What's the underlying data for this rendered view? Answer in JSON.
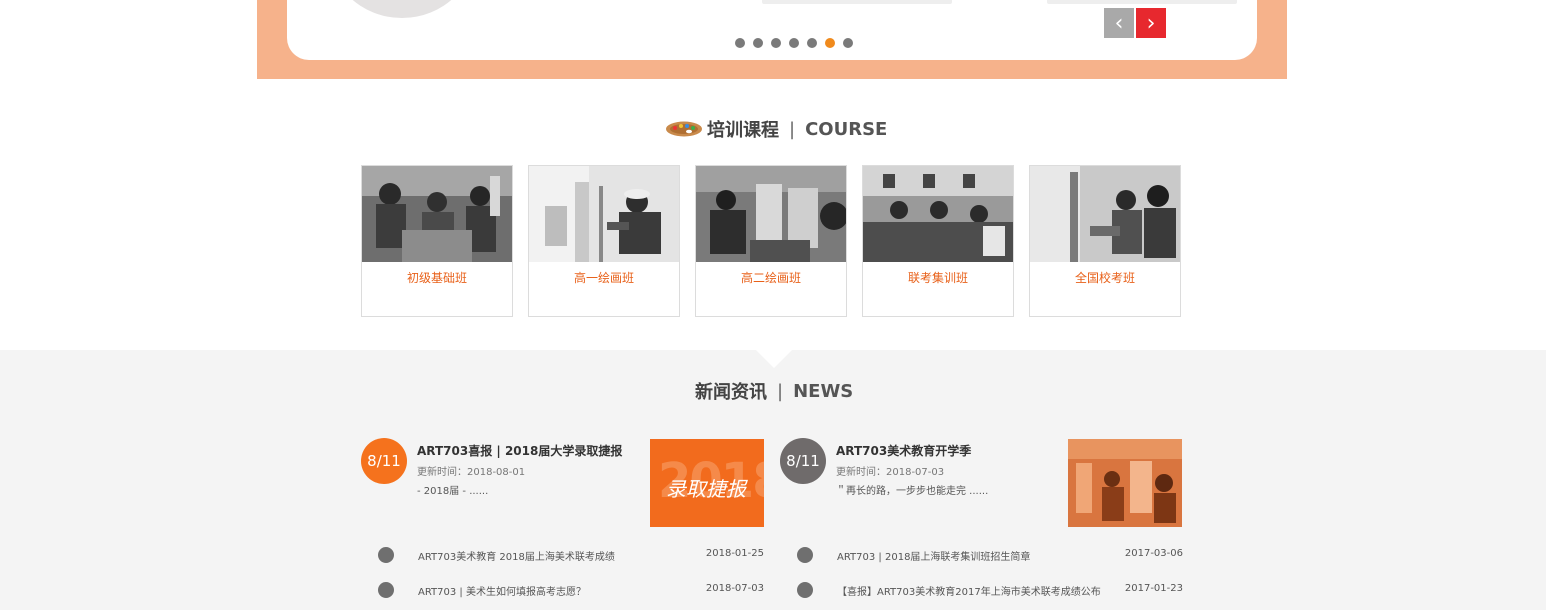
{
  "carousel": {
    "prev_arrow": "‹",
    "next_arrow": "›",
    "dot_count": 7,
    "active_dot": 6
  },
  "course": {
    "title": "培训课程",
    "divider": "|",
    "title_en": "COURSE",
    "items": [
      {
        "label": "初级基础班"
      },
      {
        "label": "高一绘画班"
      },
      {
        "label": "高二绘画班"
      },
      {
        "label": "联考集训班"
      },
      {
        "label": "全国校考班"
      }
    ]
  },
  "news": {
    "title": "新闻资讯",
    "divider": "|",
    "title_en": "NEWS",
    "featured": [
      {
        "date": "8/11",
        "headline": "ART703喜报 | 2018届大学录取捷报",
        "updated": "更新时间：2018-08-01",
        "excerpt": "- 2018届 - ......",
        "badge_color": "#f5721d",
        "image_text": "录取捷报",
        "image_year": "2018"
      },
      {
        "date": "8/11",
        "headline": "ART703美术教育开学季",
        "updated": "更新时间：2018-07-03",
        "excerpt": "＂再长的路，一步步也能走完 ......",
        "badge_color": "#6f6b6b"
      }
    ],
    "left_list": [
      {
        "text": "ART703美术教育 2018届上海美术联考成绩",
        "date": "2018-01-25"
      },
      {
        "text": "ART703 | 美术生如何填报高考志愿？",
        "date": "2018-07-03"
      }
    ],
    "right_list": [
      {
        "text": "ART703 | 2018届上海联考集训班招生简章",
        "date": "2017-03-06"
      },
      {
        "text": "【喜报】ART703美术教育2017年上海市美术联考成绩公布",
        "date": "2017-01-23"
      }
    ]
  }
}
